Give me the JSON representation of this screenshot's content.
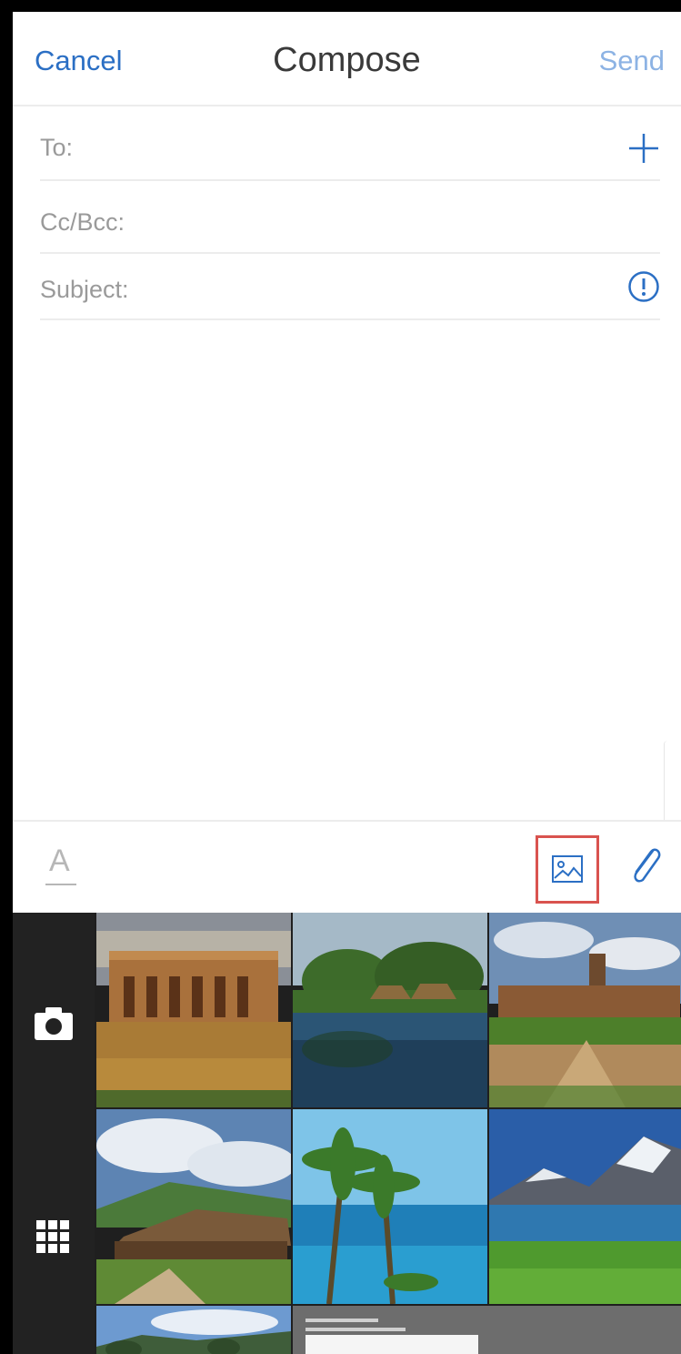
{
  "header": {
    "cancel_label": "Cancel",
    "title": "Compose",
    "send_label": "Send"
  },
  "fields": {
    "to_label": "To:",
    "cc_label": "Cc/Bcc:",
    "subject_label": "Subject:"
  },
  "toolbar": {
    "format_icon": "text-format-icon",
    "photo_icon": "photo-icon",
    "attach_icon": "paperclip-icon",
    "highlight_color": "#d9534f"
  },
  "picker": {
    "camera_icon": "camera-icon",
    "grid_icon": "grid-icon",
    "thumbnails": [
      "palace-reflection-photo",
      "pool-resort-photo",
      "castle-garden-photo",
      "hut-hills-photo",
      "palm-beach-photo",
      "mountain-lake-photo",
      "hills-landscape-photo",
      "document-screenshot-photo"
    ]
  },
  "colors": {
    "accent": "#2b6fc4",
    "send_disabled": "#8db3e4",
    "label_gray": "#9a9a9a"
  }
}
